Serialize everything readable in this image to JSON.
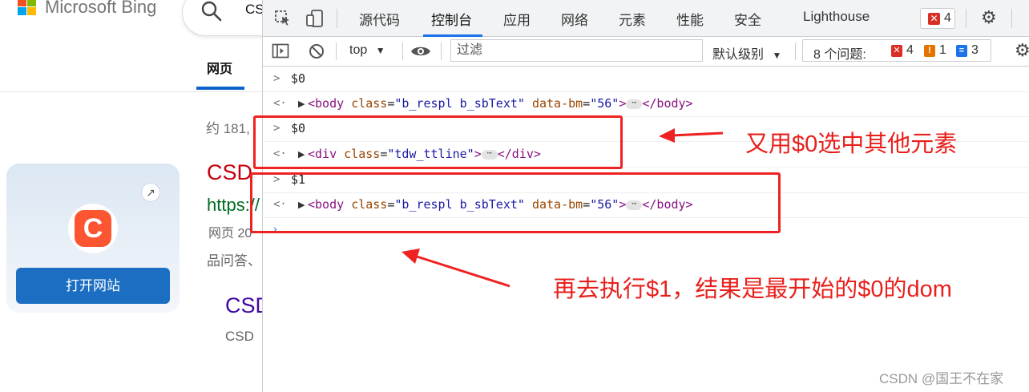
{
  "bing": {
    "brand": "Microsoft Bing",
    "query": "CSD",
    "tab_web": "网页",
    "result_count": "约 181,",
    "card": {
      "logo_letter": "C",
      "open_button": "打开网站"
    },
    "result1": {
      "title": "CSD",
      "url": "https://",
      "meta": "网页 20",
      "snippet": "品问答、"
    },
    "result2": {
      "title": "CSD",
      "sub": "CSD"
    }
  },
  "devtools": {
    "tabs": [
      "源代码",
      "控制台",
      "应用",
      "网络",
      "元素",
      "性能",
      "安全",
      "Lighthouse"
    ],
    "active_tab": "控制台",
    "error_badge_count": "4",
    "context": "top",
    "filter_placeholder": "过滤",
    "levels_label": "默认级别",
    "issues": {
      "label": "8 个问题:",
      "errors": "4",
      "warnings": "1",
      "info": "3"
    },
    "colors": {
      "accent": "#1a73e8",
      "error": "#d93025",
      "warning": "#e37400",
      "info": "#1a73e8"
    }
  },
  "console": {
    "entries": [
      {
        "kind": "input",
        "text": "$0"
      },
      {
        "kind": "output",
        "tag_open": "<body",
        "attrs": [
          {
            "name": "class",
            "value": "\"b_respl b_sbText\""
          },
          {
            "name": "data-bm",
            "value": "\"56\""
          }
        ],
        "tag_close": "</body>"
      },
      {
        "kind": "input",
        "text": "$0"
      },
      {
        "kind": "output",
        "tag_open": "<div",
        "attrs": [
          {
            "name": "class",
            "value": "\"tdw_ttline\""
          }
        ],
        "tag_close": "</div>"
      },
      {
        "kind": "input",
        "text": "$1"
      },
      {
        "kind": "output",
        "tag_open": "<body",
        "attrs": [
          {
            "name": "class",
            "value": "\"b_respl b_sbText\""
          },
          {
            "name": "data-bm",
            "value": "\"56\""
          }
        ],
        "tag_close": "</body>"
      }
    ]
  },
  "annotations": {
    "note1": "又用$0选中其他元素",
    "note2": "再去执行$1，结果是最开始的$0的dom",
    "color": "#e8201c"
  },
  "watermark": "CSDN @国王不在家"
}
